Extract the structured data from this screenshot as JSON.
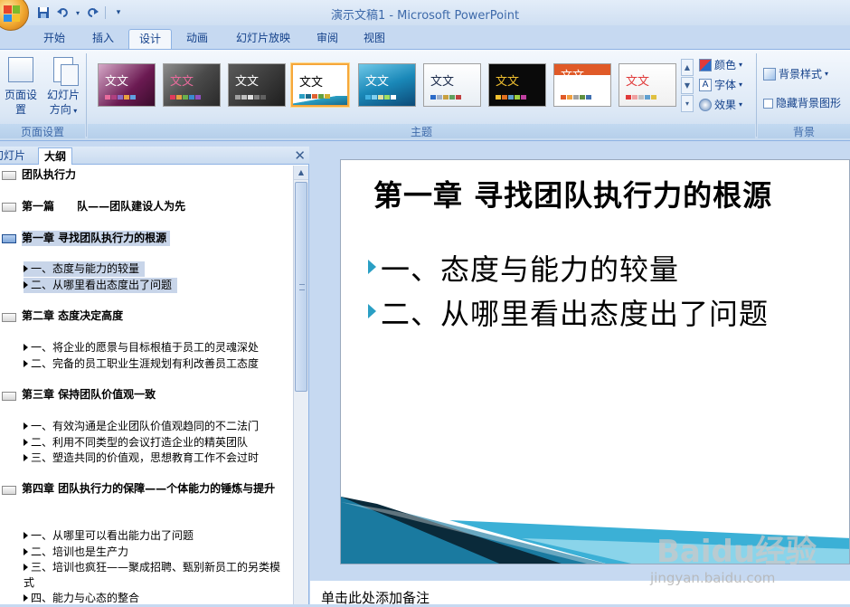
{
  "window": {
    "title": "演示文稿1 - Microsoft PowerPoint"
  },
  "quick_access": {
    "save_icon": "save-icon",
    "undo_icon": "undo-icon",
    "redo_icon": "redo-icon",
    "customize_icon": "customize-icon"
  },
  "tabs": [
    {
      "label": "开始"
    },
    {
      "label": "插入"
    },
    {
      "label": "设计"
    },
    {
      "label": "动画"
    },
    {
      "label": "幻灯片放映"
    },
    {
      "label": "审阅"
    },
    {
      "label": "视图"
    }
  ],
  "active_tab": "设计",
  "ribbon": {
    "page_setup_group": {
      "label": "页面设置",
      "page_setup": "页面设置",
      "orientation_line1": "幻灯片",
      "orientation_line2": "方向"
    },
    "themes_group": {
      "label": "主题",
      "thumb_text": "文文",
      "selected_index": 3
    },
    "theme_options": {
      "colors": "颜色",
      "fonts": "字体",
      "effects": "效果"
    },
    "background_group": {
      "label": "背景",
      "background_styles": "背景样式",
      "hide_background": "隐藏背景图形"
    }
  },
  "left_pane": {
    "tab_slides": "幻灯片",
    "tab_outline": "大纲",
    "outline": [
      {
        "title": "团队执行力",
        "bullets": []
      },
      {
        "title": "第一篇      队——团队建设人为先",
        "bullets": []
      },
      {
        "title": "第一章 寻找团队执行力的根源",
        "active": true,
        "bullets": [
          "一、态度与能力的较量",
          "二、从哪里看出态度出了问题"
        ]
      },
      {
        "title": "第二章 态度决定高度",
        "bullets": [
          "一、将企业的愿景与目标根植于员工的灵魂深处",
          "二、完备的员工职业生涯规划有利改善员工态度"
        ]
      },
      {
        "title": "第三章 保持团队价值观一致",
        "bullets": [
          "一、有效沟通是企业团队价值观趋同的不二法门",
          "二、利用不同类型的会议打造企业的精英团队",
          "三、塑造共同的价值观，思想教育工作不会过时"
        ]
      },
      {
        "title": "第四章 团队执行力的保障——个体能力的锤炼与提升",
        "bullets": [
          "一、从哪里可以看出能力出了问题",
          "二、培训也是生产力",
          "三、培训也疯狂——聚成招聘、甄别新员工的另类模式",
          "四、能力与心态的整合"
        ]
      }
    ]
  },
  "slide": {
    "title": "第一章 寻找团队执行力的根源",
    "bullets": [
      "一、态度与能力的较量",
      "二、从哪里看出态度出了问题"
    ],
    "accent_color": "#2a9fc4"
  },
  "notes": {
    "placeholder": "单击此处添加备注"
  },
  "watermark": {
    "logo": "Baidu经验",
    "url": "jingyan.baidu.com"
  }
}
